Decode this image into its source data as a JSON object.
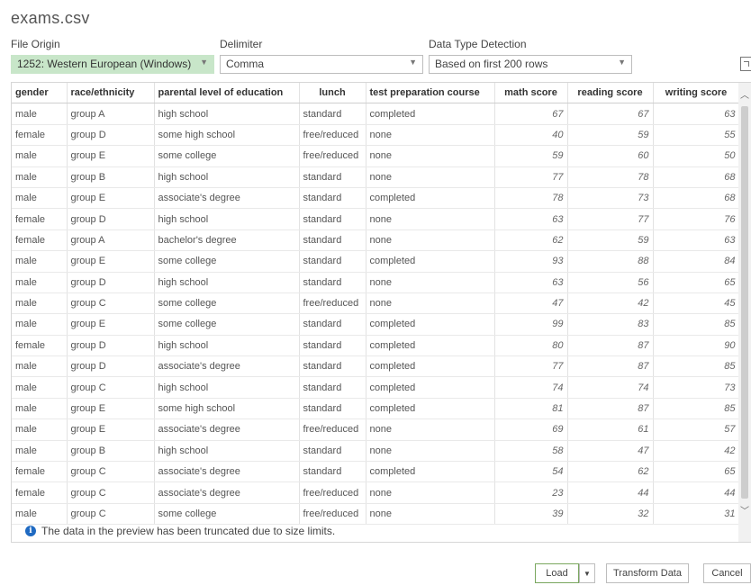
{
  "window": {
    "title": "exams.csv"
  },
  "file_origin": {
    "label": "File Origin",
    "value": "1252: Western European (Windows)"
  },
  "delimiter": {
    "label": "Delimiter",
    "value": "Comma"
  },
  "data_type_detection": {
    "label": "Data Type Detection",
    "value": "Based on first 200 rows"
  },
  "table": {
    "columns": [
      "gender",
      "race/ethnicity",
      "parental level of education",
      "lunch",
      "test preparation course",
      "math score",
      "reading score",
      "writing score"
    ],
    "rows": [
      [
        "male",
        "group A",
        "high school",
        "standard",
        "completed",
        "67",
        "67",
        "63"
      ],
      [
        "female",
        "group D",
        "some high school",
        "free/reduced",
        "none",
        "40",
        "59",
        "55"
      ],
      [
        "male",
        "group E",
        "some college",
        "free/reduced",
        "none",
        "59",
        "60",
        "50"
      ],
      [
        "male",
        "group B",
        "high school",
        "standard",
        "none",
        "77",
        "78",
        "68"
      ],
      [
        "male",
        "group E",
        "associate's degree",
        "standard",
        "completed",
        "78",
        "73",
        "68"
      ],
      [
        "female",
        "group D",
        "high school",
        "standard",
        "none",
        "63",
        "77",
        "76"
      ],
      [
        "female",
        "group A",
        "bachelor's degree",
        "standard",
        "none",
        "62",
        "59",
        "63"
      ],
      [
        "male",
        "group E",
        "some college",
        "standard",
        "completed",
        "93",
        "88",
        "84"
      ],
      [
        "male",
        "group D",
        "high school",
        "standard",
        "none",
        "63",
        "56",
        "65"
      ],
      [
        "male",
        "group C",
        "some college",
        "free/reduced",
        "none",
        "47",
        "42",
        "45"
      ],
      [
        "male",
        "group E",
        "some college",
        "standard",
        "completed",
        "99",
        "83",
        "85"
      ],
      [
        "female",
        "group D",
        "high school",
        "standard",
        "completed",
        "80",
        "87",
        "90"
      ],
      [
        "male",
        "group D",
        "associate's degree",
        "standard",
        "completed",
        "77",
        "87",
        "85"
      ],
      [
        "male",
        "group C",
        "high school",
        "standard",
        "completed",
        "74",
        "74",
        "73"
      ],
      [
        "male",
        "group E",
        "some high school",
        "standard",
        "completed",
        "81",
        "87",
        "85"
      ],
      [
        "male",
        "group E",
        "associate's degree",
        "free/reduced",
        "none",
        "69",
        "61",
        "57"
      ],
      [
        "male",
        "group B",
        "high school",
        "standard",
        "none",
        "58",
        "47",
        "42"
      ],
      [
        "female",
        "group C",
        "associate's degree",
        "standard",
        "completed",
        "54",
        "62",
        "65"
      ],
      [
        "female",
        "group C",
        "associate's degree",
        "free/reduced",
        "none",
        "23",
        "44",
        "44"
      ],
      [
        "male",
        "group C",
        "some college",
        "free/reduced",
        "none",
        "39",
        "32",
        "31"
      ]
    ]
  },
  "notice": {
    "text": "The data in the preview has been truncated due to size limits."
  },
  "footer": {
    "load": "Load",
    "transform": "Transform Data",
    "cancel": "Cancel"
  },
  "colors": {
    "selected_dropdown": "#c8e6c9",
    "info_icon": "#1f6ac2",
    "load_border": "#7aa75f"
  }
}
